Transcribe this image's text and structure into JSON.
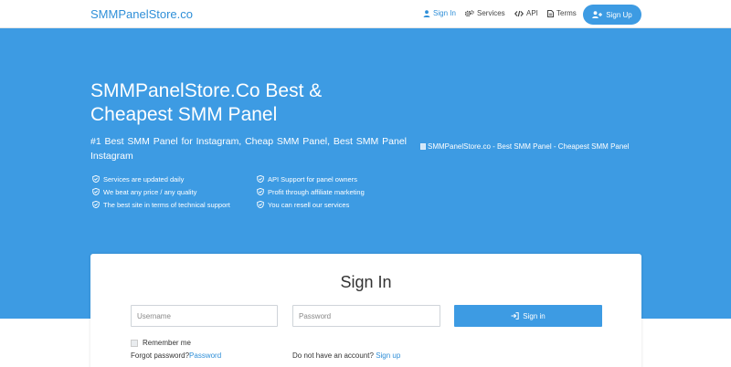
{
  "navbar": {
    "brand": "SMMPanelStore.co",
    "items": [
      {
        "label": "Sign In",
        "icon": "user-icon",
        "active": true
      },
      {
        "label": "Services",
        "icon": "gears-icon"
      },
      {
        "label": "API",
        "icon": "code-icon"
      },
      {
        "label": "Terms",
        "icon": "document-icon"
      }
    ],
    "signup_label": "Sign Up",
    "signup_icon": "user-plus-icon"
  },
  "hero": {
    "title": "SMMPanelStore.Co Best & Cheapest SMM Panel",
    "subtitle": "#1 Best SMM Panel for Instagram, Cheap SMM Panel, Best SMM Panel Instagram",
    "image_alt": "SMMPanelStore.co - Best SMM Panel - Cheapest SMM Panel",
    "features_left": [
      "Services are updated daily",
      "We beat any price / any quality",
      "The best site in terms of technical support"
    ],
    "features_right": [
      "API Support for panel owners",
      "Profit through affiliate marketing",
      "You can resell our services"
    ],
    "feature_icon": "check-shield-icon"
  },
  "signin": {
    "title": "Sign In",
    "username_placeholder": "Username",
    "password_placeholder": "Password",
    "button_label": "Sign in",
    "button_icon": "sign-in-icon",
    "remember_label": "Remember me",
    "forgot_text": "Forgot password?",
    "forgot_link": "Password",
    "no_account_text": "Do not have an account?",
    "signup_link": "Sign up"
  },
  "colors": {
    "brand": "#2f8fd8",
    "hero_background": "#3d9be3",
    "button": "#3d9be3"
  }
}
